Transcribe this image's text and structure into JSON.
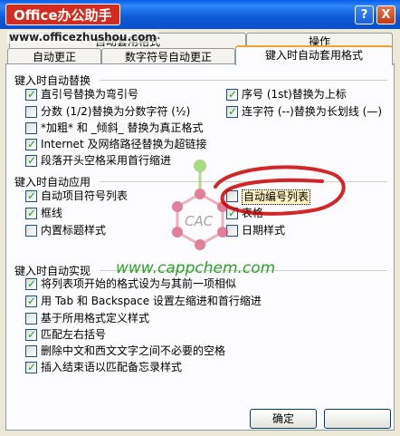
{
  "window": {
    "watermark_title": "Office办公助手",
    "help_icon": "help-icon",
    "close_icon": "close-icon",
    "help_glyph": "?",
    "close_glyph": "X"
  },
  "url_watermark": "www.officezhushou.com",
  "tabs_row_back": [
    {
      "label": "自动套用格式"
    },
    {
      "label": "操作"
    }
  ],
  "tabs_row_front": [
    {
      "label": "自动更正"
    },
    {
      "label": "数字符号自动更正"
    },
    {
      "label": "键入时自动套用格式"
    }
  ],
  "section_replace": {
    "title": "键入时自动替换",
    "left": [
      {
        "label": "直引号替换为弯引号",
        "checked": true
      },
      {
        "label": "分数 (1/2)替换为分数字符 (½)",
        "checked": false
      },
      {
        "label": "*加粗* 和 _倾斜_ 替换为真正格式",
        "checked": false
      },
      {
        "label": "Internet 及网络路径替换为超链接",
        "checked": true
      },
      {
        "label": "段落开头空格采用首行缩进",
        "checked": true
      }
    ],
    "right": [
      {
        "label": "序号 (1st)替换为上标",
        "checked": true
      },
      {
        "label": "连字符 (--)替换为长划线 (—)",
        "checked": true
      }
    ]
  },
  "section_apply": {
    "title": "键入时自动应用",
    "left": [
      {
        "label": "自动项目符号列表",
        "checked": true
      },
      {
        "label": "框线",
        "checked": true
      },
      {
        "label": "内置标题样式",
        "checked": false
      }
    ],
    "right": [
      {
        "label": "自动编号列表",
        "checked": false
      },
      {
        "label": "表格",
        "checked": true
      },
      {
        "label": "日期样式",
        "checked": false
      }
    ]
  },
  "section_implement": {
    "title": "键入时自动实现",
    "items": [
      {
        "label": "将列表项开始的格式设为与其前一项相似",
        "checked": true
      },
      {
        "label": "用 Tab 和 Backspace 设置左缩进和首行缩进",
        "checked": true
      },
      {
        "label": "基于所用格式定义样式",
        "checked": false
      },
      {
        "label": "匹配左右括号",
        "checked": true
      },
      {
        "label": "删除中文和西文文字之间不必要的空格",
        "checked": false
      },
      {
        "label": "插入结束语以匹配备忘录样式",
        "checked": true
      }
    ]
  },
  "buttons": {
    "ok": "确定"
  },
  "watermarks": {
    "cac_text": "CAC",
    "site": "www.cappchem.com"
  },
  "colors": {
    "title_bar": "#0a5de8",
    "panel": "#fcfcfe",
    "accent_tab": "#f1a430",
    "annotation": "#cc0000"
  }
}
